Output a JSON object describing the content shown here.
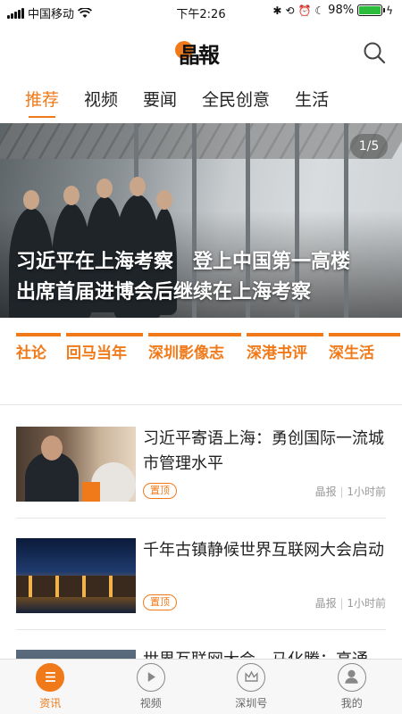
{
  "status_bar": {
    "carrier": "中国移动",
    "time": "下午2:26",
    "battery_percent": "98%",
    "battery_level": 0.98
  },
  "header": {
    "logo_text": "晶報",
    "search_icon": "search-icon"
  },
  "tabs": [
    {
      "label": "推荐",
      "active": true
    },
    {
      "label": "视频",
      "active": false
    },
    {
      "label": "要闻",
      "active": false
    },
    {
      "label": "全民创意",
      "active": false
    },
    {
      "label": "生活",
      "active": false
    }
  ],
  "hero": {
    "page_indicator": "1/5",
    "title_line1": "习近平在上海考察　登上中国第一高楼",
    "title_line2": "出席首届进博会后继续在上海考察"
  },
  "columns": [
    {
      "label": "社论"
    },
    {
      "label": "回马当年"
    },
    {
      "label": "深圳影像志"
    },
    {
      "label": "深港书评"
    },
    {
      "label": "深生活"
    }
  ],
  "news": [
    {
      "title": "习近平寄语上海：勇创国际一流城市管理水平",
      "badge": "置顶",
      "source": "晶报",
      "time": "1小时前"
    },
    {
      "title": "千年古镇静候世界互联网大会启动",
      "badge": "置顶",
      "source": "晶报",
      "time": "1小时前"
    },
    {
      "title": "世界互联网大会，马化腾：高通",
      "badge": "",
      "source": "",
      "time": ""
    }
  ],
  "bottom_nav": [
    {
      "label": "资讯",
      "icon": "list-icon",
      "active": true
    },
    {
      "label": "视频",
      "icon": "play-icon",
      "active": false
    },
    {
      "label": "深圳号",
      "icon": "crown-icon",
      "active": false
    },
    {
      "label": "我的",
      "icon": "user-icon",
      "active": false
    }
  ],
  "colors": {
    "accent": "#f07a1a",
    "battery": "#2dbd3c"
  }
}
